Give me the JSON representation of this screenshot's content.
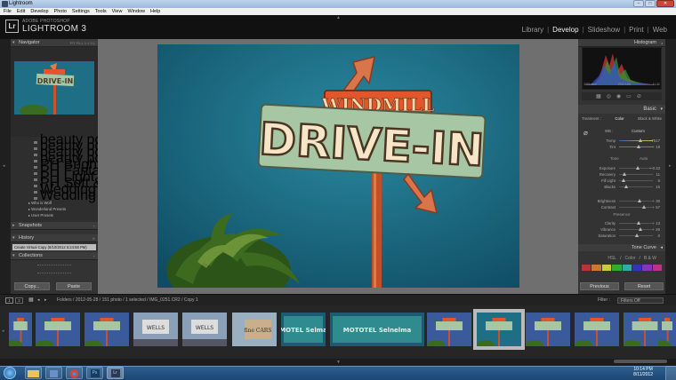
{
  "window": {
    "title": "Lightroom"
  },
  "menu": [
    "File",
    "Edit",
    "Develop",
    "Photo",
    "Settings",
    "Tools",
    "View",
    "Window",
    "Help"
  ],
  "brand": {
    "top": "ADOBE PHOTOSHOP",
    "name": "LIGHTROOM 3",
    "badge": "Lr"
  },
  "modules": [
    {
      "label": "Library",
      "active": false
    },
    {
      "label": "Develop",
      "active": true
    },
    {
      "label": "Slideshow",
      "active": false
    },
    {
      "label": "Print",
      "active": false
    },
    {
      "label": "Web",
      "active": false
    }
  ],
  "left": {
    "navigator": {
      "title": "Navigator",
      "options": "FIT FILL 1:1 3:1"
    },
    "presets": [
      "beauty pop",
      "beauty pop2",
      "beauty pop3",
      "beauty pop4",
      "PH Bright Beauty",
      "PH Fantasy dress",
      "PH Light dress",
      "PH Soft & Dreamy",
      "Wedding Look",
      "Wedding Look Bright"
    ],
    "folders": [
      "Who is Wolf",
      "Wonderland Presets",
      "User Presets"
    ],
    "snapshots": {
      "title": "Snapshots"
    },
    "history": {
      "title": "History",
      "item": "Create Virtual Copy (8/10/2012 5:24:58 PM)"
    },
    "collections": {
      "title": "Collections"
    },
    "copy_label": "Copy...",
    "paste_label": "Paste"
  },
  "sign": {
    "top": "WINDMILL",
    "main": "DRIVE-IN"
  },
  "right": {
    "histogram_title": "Histogram",
    "basic_title": "Basic",
    "treatment": {
      "label": "Treatment :",
      "color": "Color",
      "bw": "Black & White"
    },
    "wb": {
      "label": "WB :",
      "value": "Custom"
    },
    "temp": {
      "label": "Temp",
      "value": "7517",
      "pos": 0.6
    },
    "tint": {
      "label": "Tint",
      "value": "+ 19",
      "pos": 0.55
    },
    "tone": {
      "label": "Tone",
      "auto": "Auto"
    },
    "sliders": [
      {
        "label": "Exposure",
        "value": "+ 0.33",
        "pos": 0.53
      },
      {
        "label": "Recovery",
        "value": "11",
        "pos": 0.12
      },
      {
        "label": "Fill Light",
        "value": "6",
        "pos": 0.08
      },
      {
        "label": "Blacks",
        "value": "16",
        "pos": 0.18
      },
      {
        "label": "Brightness",
        "value": "+ 30",
        "pos": 0.58
      },
      {
        "label": "Contrast",
        "value": "+ 57",
        "pos": 0.72
      }
    ],
    "presence": "Presence",
    "presence_sliders": [
      {
        "label": "Clarity",
        "value": "+ 13",
        "pos": 0.56
      },
      {
        "label": "Vibrance",
        "value": "+ 26",
        "pos": 0.62
      },
      {
        "label": "Saturation",
        "value": "0",
        "pos": 0.5
      }
    ],
    "tonecurve": "Tone Curve",
    "hsl": {
      "h": "HSL",
      "c": "Color",
      "bw": "B & W"
    },
    "previous_label": "Previous",
    "reset_label": "Reset"
  },
  "filmbar": {
    "path": "Folders / 2012-05-28 / 151 photo / 1 selected / IMG_0251.CR2 / Copy 1",
    "filter_label": "Filter :",
    "filter_value": "Filters Off",
    "pages": [
      "1",
      "2"
    ]
  },
  "thumbnails": [
    {
      "kind": "sign"
    },
    {
      "kind": "sign"
    },
    {
      "kind": "sign"
    },
    {
      "kind": "wells",
      "text": "WELLS"
    },
    {
      "kind": "wells",
      "text": "WELLS"
    },
    {
      "kind": "cars",
      "text": "fine CARS"
    },
    {
      "kind": "motel",
      "text": "MOTEL Selma"
    },
    {
      "kind": "motel",
      "text": "MOTOTEL Selnelma"
    },
    {
      "kind": "sign"
    },
    {
      "kind": "selected"
    },
    {
      "kind": "sign"
    },
    {
      "kind": "sign"
    },
    {
      "kind": "sign"
    },
    {
      "kind": "sign"
    }
  ],
  "taskbar": {
    "time": "10:14 PM",
    "date": "8/11/2012",
    "ps": "Ps",
    "lr": "Lr"
  },
  "colors": {
    "accent": "#e3562b",
    "signgreen": "#a7c6a4",
    "sky": "#1b6f86"
  }
}
